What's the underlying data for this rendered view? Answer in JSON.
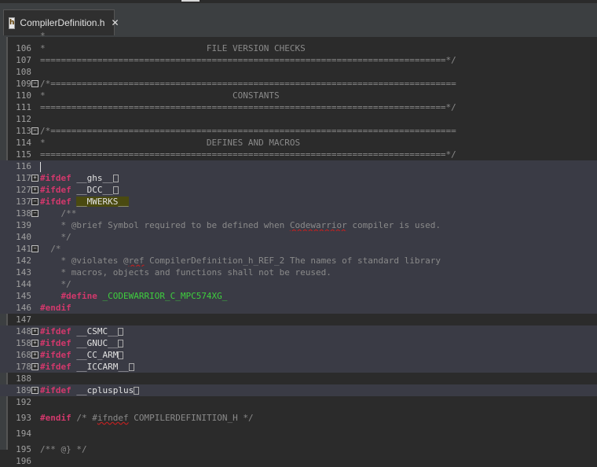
{
  "tab": {
    "title": "CompilerDefinition.h",
    "icon": "h-file-icon"
  },
  "lines": [
    {
      "n": "106",
      "text": "*                               FILE VERSION CHECKS"
    },
    {
      "n": "107",
      "text": "==============================================================================*/"
    },
    {
      "n": "108",
      "text": ""
    },
    {
      "n": "109",
      "text": "/*=============================================================================="
    },
    {
      "n": "110",
      "text": "*                                    CONSTANTS"
    },
    {
      "n": "111",
      "text": "==============================================================================*/"
    },
    {
      "n": "112",
      "text": ""
    },
    {
      "n": "113",
      "text": "/*=============================================================================="
    },
    {
      "n": "114",
      "text": "*                               DEFINES AND MACROS"
    },
    {
      "n": "115",
      "text": "==============================================================================*/"
    },
    {
      "n": "116",
      "text": ""
    },
    {
      "n": "117",
      "kw": "#ifdef",
      "id": "__ghs__"
    },
    {
      "n": "127",
      "kw": "#ifdef",
      "id": "__DCC__"
    },
    {
      "n": "137",
      "kw": "#ifdef",
      "id": "__MWERKS__"
    },
    {
      "n": "138",
      "text": "    /**"
    },
    {
      "n": "139",
      "text": "    * @brief Symbol required to be defined when Codewarrior compiler is used."
    },
    {
      "n": "140",
      "text": "    */"
    },
    {
      "n": "141",
      "text": "  /*"
    },
    {
      "n": "142",
      "text": "    * @violates @ref CompilerDefinition_h_REF_2 The names of standard library"
    },
    {
      "n": "143",
      "text": "    * macros, objects and functions shall not be reused."
    },
    {
      "n": "144",
      "text": "    */"
    },
    {
      "n": "145",
      "kw": "#define",
      "mac": "_CODEWARRIOR_C_MPC574XG_"
    },
    {
      "n": "146",
      "kw": "#endif"
    },
    {
      "n": "147",
      "text": ""
    },
    {
      "n": "148",
      "kw": "#ifdef",
      "id": "__CSMC__"
    },
    {
      "n": "158",
      "kw": "#ifdef",
      "id": "__GNUC__"
    },
    {
      "n": "168",
      "kw": "#ifdef",
      "id": "__CC_ARM"
    },
    {
      "n": "178",
      "kw": "#ifdef",
      "id": "__ICCARM__"
    },
    {
      "n": "188",
      "text": ""
    },
    {
      "n": "189",
      "kw": "#ifdef",
      "id": "__cplusplus"
    },
    {
      "n": "192",
      "text": ""
    },
    {
      "n": "193",
      "kw": "#endif",
      "text": " /* #ifndef COMPILERDEFINITION_H */"
    },
    {
      "n": "194",
      "text": ""
    },
    {
      "n": "195",
      "text": "/** @} */"
    },
    {
      "n": "196",
      "text": ""
    }
  ]
}
